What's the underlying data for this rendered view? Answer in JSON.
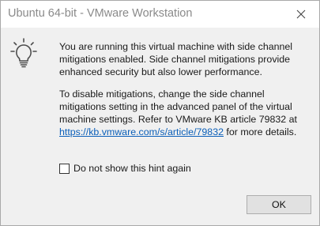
{
  "window": {
    "title": "Ubuntu 64-bit - VMware Workstation"
  },
  "icons": {
    "hint": "lightbulb-icon",
    "close": "close-icon"
  },
  "message": {
    "paragraph1": "You are running this virtual machine with side channel mitigations enabled. Side channel mitigations provide enhanced security but also lower performance.",
    "paragraph2_before_link": "To disable mitigations, change the side channel mitigations setting in the advanced panel of the virtual machine settings. Refer to VMware KB article 79832 at ",
    "link_text": "https://kb.vmware.com/s/article/79832",
    "paragraph2_after_link": " for more details."
  },
  "checkbox": {
    "label": "Do not show this hint again",
    "checked": false
  },
  "buttons": {
    "ok_label": "OK"
  },
  "colors": {
    "link": "#0b5fb9",
    "body_background": "#f0f0f0",
    "title_text": "#8a8a8a"
  }
}
